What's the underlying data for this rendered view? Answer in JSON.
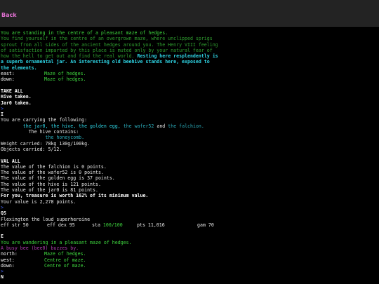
{
  "header": {
    "back_label": "Back"
  },
  "room1": {
    "title": "You are standing in the centre of a pleasant maze of hedges.",
    "desc": [
      "You find yourself in the centre of an overgrown maze, where unclipped sprigs",
      "sprout from all sides of the ancient hedges around you. The Henry VIII feeling",
      "of satisfaction imparted by this place is muted only by your natural fear of",
      "how the hell to get out and find the real world."
    ],
    "desc_tail_1": " Resting here resplendently is",
    "desc_tail_2": "a superb ornamental jar. An interesting old beehive stands here, exposed to",
    "desc_tail_3": "the elements.",
    "exits": [
      {
        "dir": "east:",
        "dest": "Maze of hedges."
      },
      {
        "dir": "down:",
        "dest": "Maze of hedges."
      }
    ]
  },
  "take": {
    "command": "TAKE ALL",
    "responses": [
      "Hive taken.",
      "Jar0 taken."
    ]
  },
  "inventory": {
    "prompt": ">",
    "command": "I",
    "header": "You are carrying the following:",
    "items_a": "the jar0, the hive, the golden egg,",
    "items_b": "the wafer52",
    "items_c": "and",
    "items_d": "the falchion.",
    "hive_contains": "The hive contains:",
    "hive_item": "the honeycomb.",
    "weight": "Weight carried: 78kg 130g/100kg.",
    "objects": "Objects carried: 5/12."
  },
  "value": {
    "command": "VAL ALL",
    "lines": [
      "The value of the falchion is 0 points.",
      "The value of the wafer52 is 0 points.",
      "The value of the golden egg is 37 points.",
      "The value of the hive is 121 points.",
      "The value of the jar0 is 81 points."
    ],
    "summary": "For you, treasure is worth 162% of its minimum value.",
    "total": "Your value is 2,278 points."
  },
  "qs": {
    "prompt": ">",
    "command": "QS",
    "name": "Flexington the loud superheroine",
    "str_label": "eff str 50",
    "dex_label": "eff dex 95",
    "sta_label": "sta",
    "sta_value": "100/100",
    "pts_label": "pts 11,016",
    "gam_label": "gam 70"
  },
  "room2": {
    "command": "E",
    "title": "You are wandering in a pleasant maze of hedges.",
    "event": "A busy bee (bee0) buzzes by.",
    "exits": [
      {
        "dir": "north:",
        "dest": "Maze of hedges."
      },
      {
        "dir": "west:",
        "dest": "Centre of maze."
      },
      {
        "dir": "down:",
        "dest": "Centre of maze."
      }
    ]
  },
  "footer": {
    "prompt": ">",
    "command": "N"
  },
  "colors": {
    "accent_link": "#e070d0",
    "room_title": "#3fd83f",
    "description": "#2f9e2f",
    "highlight": "#2fd6e6"
  }
}
